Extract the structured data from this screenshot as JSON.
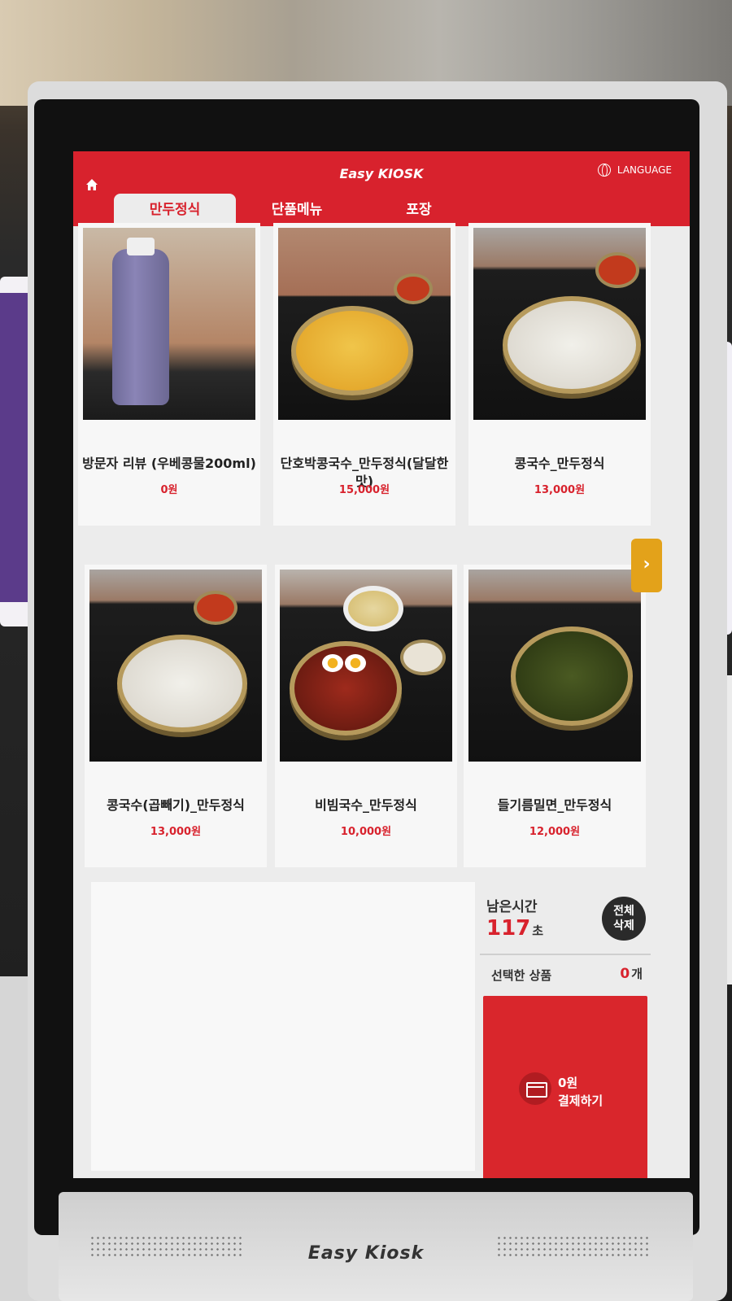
{
  "header": {
    "logo": "Easy KIOSK",
    "language_label": "LANGUAGE"
  },
  "tabs": [
    {
      "label": "만두정식",
      "active": true
    },
    {
      "label": "단품메뉴",
      "active": false
    },
    {
      "label": "포장",
      "active": false
    }
  ],
  "menu": [
    {
      "name": "방문자 리뷰 (우베콩물200ml)",
      "price": "0원",
      "image": "bottle"
    },
    {
      "name": "단호박콩국수_만두정식(달달한맛)",
      "price": "15,000원",
      "image": "yellow-soup"
    },
    {
      "name": "콩국수_만두정식",
      "price": "13,000원",
      "image": "white-soup"
    },
    {
      "name": "콩국수(곱빼기)_만두정식",
      "price": "13,000원",
      "image": "white-soup"
    },
    {
      "name": "비빔국수_만두정식",
      "price": "10,000원",
      "image": "bibim"
    },
    {
      "name": "들기름밀면_만두정식",
      "price": "12,000원",
      "image": "green-noodle"
    }
  ],
  "summary": {
    "time_label": "남은시간",
    "time_value": "117",
    "time_unit": "초",
    "clear_label_1": "전체",
    "clear_label_2": "삭제",
    "selected_label": "선택한 상품",
    "selected_count": "0",
    "selected_unit": "개",
    "pay_amount": "0원",
    "pay_label": "결제하기"
  },
  "device_brand": "Easy Kiosk",
  "colors": {
    "brand_red": "#d8222d",
    "arrow_orange": "#e3a21a"
  }
}
